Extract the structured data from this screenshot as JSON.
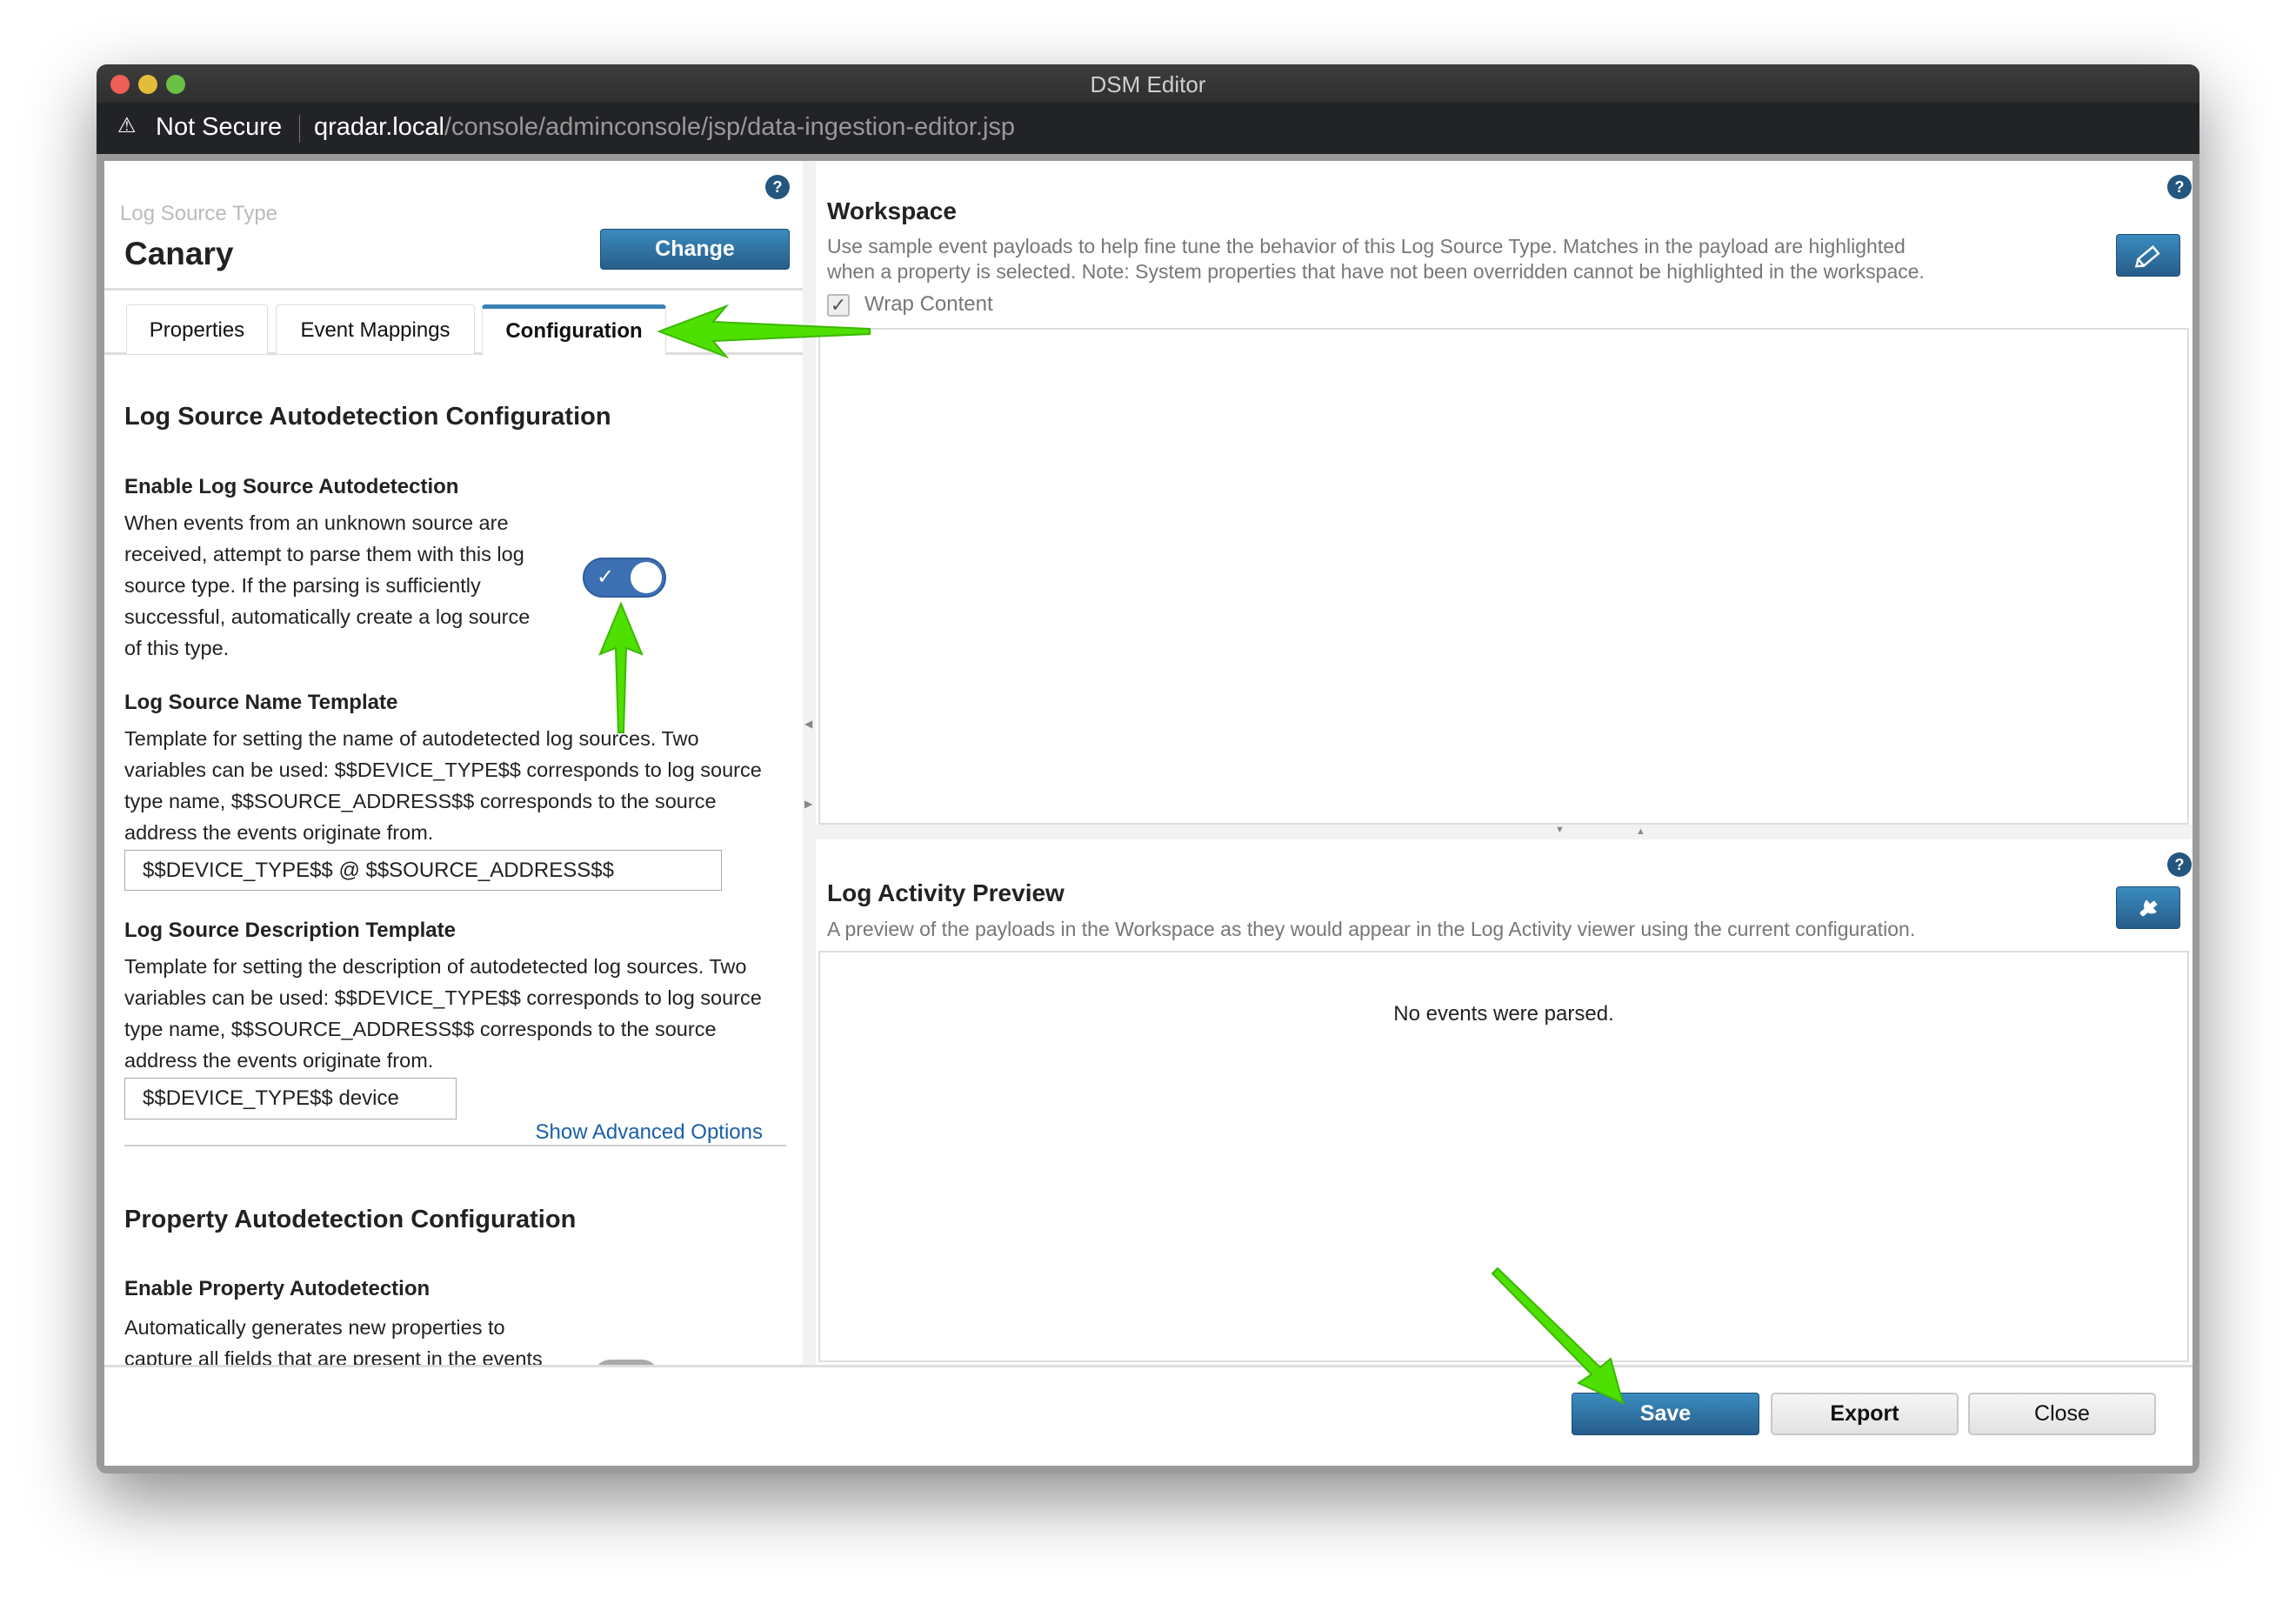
{
  "window": {
    "title": "DSM Editor"
  },
  "address_bar": {
    "security": "Not Secure",
    "host": "qradar.local",
    "path": "/console/adminconsole/jsp/data-ingestion-editor.jsp"
  },
  "left": {
    "type_label": "Log Source Type",
    "type_value": "Canary",
    "change_label": "Change",
    "help": "?",
    "tabs": [
      {
        "label": "Properties"
      },
      {
        "label": "Event Mappings"
      },
      {
        "label": "Configuration",
        "active": true
      }
    ],
    "section1_title": "Log Source Autodetection Configuration",
    "enable_title": "Enable Log Source Autodetection",
    "enable_desc": "When events from an unknown source are received, attempt to parse them with this log source type. If the parsing is sufficiently successful, automatically create a log source of this type.",
    "enable_on": true,
    "name_title": "Log Source Name Template",
    "name_desc": "Template for setting the name of autodetected log sources. Two variables can be used: $$DEVICE_TYPE$$ corresponds to log source type name, $$SOURCE_ADDRESS$$ corresponds to the source address the events originate from.",
    "name_value": "$$DEVICE_TYPE$$ @ $$SOURCE_ADDRESS$$",
    "descr_title": "Log Source Description Template",
    "descr_desc": "Template for setting the description of autodetected log sources. Two variables can be used: $$DEVICE_TYPE$$ corresponds to log source type name, $$SOURCE_ADDRESS$$ corresponds to the source address the events originate from.",
    "descr_value": "$$DEVICE_TYPE$$ device",
    "advanced_link": "Show Advanced Options",
    "section2_title": "Property Autodetection Configuration",
    "prop_title": "Enable Property Autodetection",
    "prop_desc": "Automatically generates new properties to capture all fields that are present in the events"
  },
  "workspace": {
    "title": "Workspace",
    "desc1": "Use sample event payloads to help fine tune the behavior of this Log Source Type. Matches in the payload are highlighted",
    "desc2": "when a property is selected. Note: System properties that have not been overridden cannot be highlighted in the workspace.",
    "wrap_label": "Wrap Content",
    "wrap_checked": true,
    "help": "?",
    "edit_icon": "pencil-icon"
  },
  "preview": {
    "title": "Log Activity Preview",
    "desc": "A preview of the payloads in the Workspace as they would appear in the Log Activity viewer using the current configuration.",
    "empty": "No events were parsed.",
    "help": "?",
    "config_icon": "wrench-icon"
  },
  "footer": {
    "save": "Save",
    "export": "Export",
    "close": "Close"
  },
  "colors": {
    "accent": "#2a6496",
    "annotation_arrow": "#4ee000"
  }
}
